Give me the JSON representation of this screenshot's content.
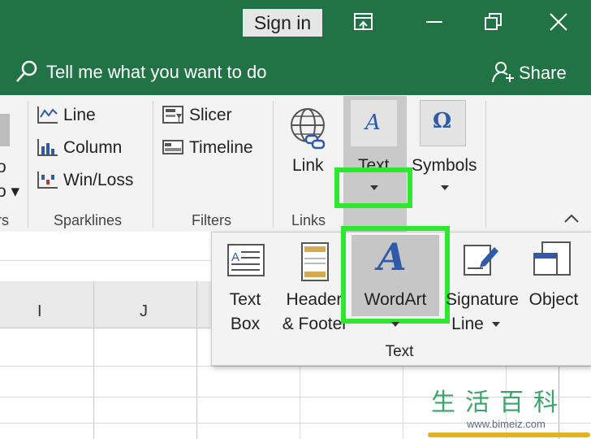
{
  "titlebar": {
    "sign_in_label": "Sign in",
    "tell_me": "Tell me what you want to do",
    "share_label": "Share"
  },
  "ribbon": {
    "partial_left_group": "rs",
    "sparklines": {
      "items": [
        "Line",
        "Column",
        "Win/Loss"
      ],
      "group_label": "Sparklines"
    },
    "filters": {
      "items": [
        "Slicer",
        "Timeline"
      ],
      "group_label": "Filters"
    },
    "links": {
      "link_label": "Link",
      "group_label": "Links"
    },
    "text_button_label": "Text",
    "symbols_label": "Symbols"
  },
  "sheet": {
    "columns": [
      "I",
      "J"
    ]
  },
  "text_panel": {
    "items": [
      {
        "line1": "Text",
        "line2": "Box"
      },
      {
        "line1": "Header",
        "line2": "& Footer"
      },
      {
        "line1": "WordArt",
        "line2": ""
      },
      {
        "line1": "Signature",
        "line2": "Line"
      },
      {
        "line1": "Object",
        "line2": ""
      }
    ],
    "group_label": "Text"
  },
  "watermark": {
    "chars": "生活百科",
    "url": "www.bimeiz.com"
  },
  "colors": {
    "excel_green": "#217346",
    "highlight_green": "#2ee830",
    "wordart_blue": "#2e5aa8"
  }
}
